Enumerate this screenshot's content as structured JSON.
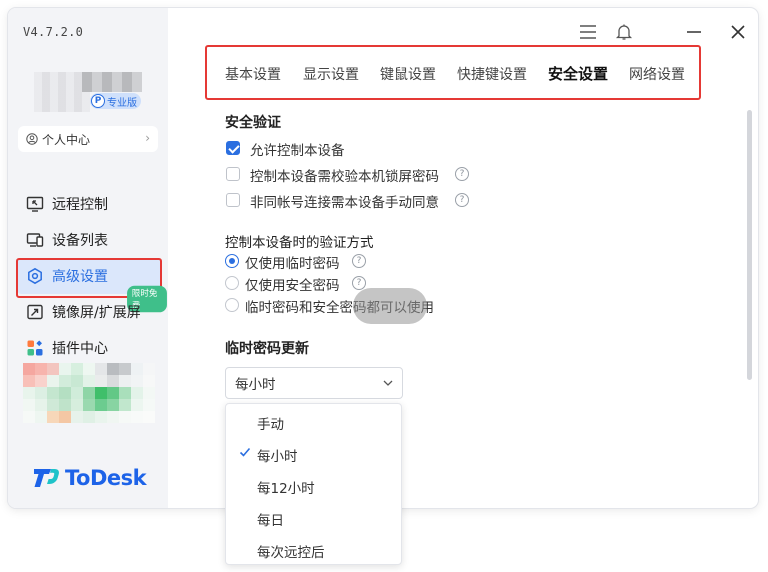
{
  "app": {
    "version": "V4.7.2.0",
    "brand": "ToDesk"
  },
  "profile": {
    "badge": "专业版",
    "badge_letter": "P",
    "user_center": "个人中心"
  },
  "nav": {
    "items": [
      {
        "label": "远程控制",
        "icon": "monitor-arrow-icon"
      },
      {
        "label": "设备列表",
        "icon": "device-list-icon"
      },
      {
        "label": "高级设置",
        "icon": "settings-hex-icon"
      },
      {
        "label": "镜像屏/扩展屏",
        "icon": "mirror-screen-icon"
      },
      {
        "label": "插件中心",
        "icon": "plugins-icon"
      }
    ],
    "new_badge": "限时免费",
    "active_index": 2
  },
  "window_controls": [
    "menu-icon",
    "bell-icon",
    "minimize-icon",
    "close-icon"
  ],
  "tabs": [
    {
      "label": "基本设置"
    },
    {
      "label": "显示设置"
    },
    {
      "label": "键鼠设置"
    },
    {
      "label": "快捷键设置"
    },
    {
      "label": "安全设置"
    },
    {
      "label": "网络设置"
    }
  ],
  "active_tab": "安全设置",
  "security": {
    "title": "安全验证",
    "options": [
      {
        "label": "允许控制本设备",
        "checked": true
      },
      {
        "label": "控制本设备需校验本机锁屏密码",
        "checked": false
      },
      {
        "label": "非同帐号连接需本设备手动同意",
        "checked": false
      }
    ]
  },
  "verify": {
    "title": "控制本设备时的验证方式",
    "options": [
      {
        "label": "仅使用临时密码",
        "selected": true
      },
      {
        "label": "仅使用安全密码",
        "selected": false
      },
      {
        "label": "临时密码和安全密码都可以使用",
        "selected": false
      }
    ]
  },
  "temp_pwd": {
    "title": "临时密码更新",
    "selected": "每小时",
    "options": [
      "手动",
      "每小时",
      "每12小时",
      "每日",
      "每次远控后"
    ]
  },
  "colors": {
    "accent": "#2b6fe0",
    "highlight": "#e53935",
    "badge_green": "#3fbf8a"
  }
}
